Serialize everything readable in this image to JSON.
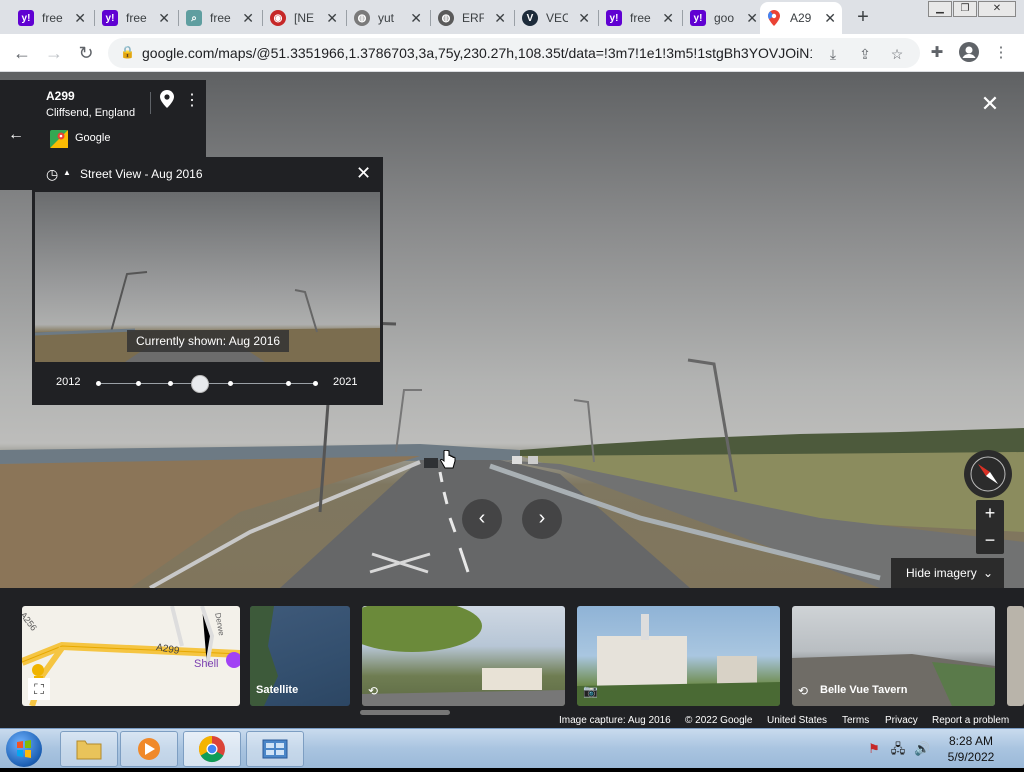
{
  "browser": {
    "tabs": [
      {
        "title": "free",
        "icon": "yahoo-icon",
        "color": "#6001d2"
      },
      {
        "title": "free",
        "icon": "yahoo-icon",
        "color": "#6001d2"
      },
      {
        "title": "free",
        "icon": "search-doc-icon",
        "color": "#5f9ea0"
      },
      {
        "title": "[NE",
        "icon": "ne-logo-icon",
        "color": "#c62828"
      },
      {
        "title": "yut",
        "icon": "globe-icon",
        "color": "#7a7a7a"
      },
      {
        "title": "ERF",
        "icon": "globe-icon",
        "color": "#5a5a5a"
      },
      {
        "title": "VEC",
        "icon": "v-logo-icon",
        "color": "#1d2b3a"
      },
      {
        "title": "free",
        "icon": "yahoo-icon",
        "color": "#6001d2"
      },
      {
        "title": "goo",
        "icon": "yahoo-icon",
        "color": "#6001d2"
      },
      {
        "title": "A29",
        "icon": "google-maps-icon",
        "color": "#34a853",
        "active": true
      }
    ],
    "url": "google.com/maps/@51.3351966,1.3786703,3a,75y,230.27h,108.35t/data=!3m7!1e1!3m5!1stgBh3YOVJOiN1..."
  },
  "location": {
    "road": "A299",
    "place": "Cliffsend, England",
    "provider": "Google"
  },
  "time_machine": {
    "header": "Street View - Aug 2016",
    "tooltip": "Currently shown: Aug 2016",
    "start_year": "2012",
    "end_year": "2021",
    "selected_fraction": 0.47
  },
  "controls": {
    "hide_imagery": "Hide imagery",
    "zoom_in": "+",
    "zoom_out": "−"
  },
  "filmstrip": {
    "satellite_label": "Satellite",
    "tavern_label": "Belle Vue Tavern",
    "map_labels": {
      "road1": "A256",
      "road2": "A299",
      "poi": "Shell",
      "road3": "Derwe"
    }
  },
  "footer": {
    "capture": "Image capture: Aug 2016",
    "copyright": "© 2022 Google",
    "country": "United States",
    "terms": "Terms",
    "privacy": "Privacy",
    "report": "Report a problem"
  },
  "taskbar": {
    "time": "8:28 AM",
    "date": "5/9/2022"
  }
}
